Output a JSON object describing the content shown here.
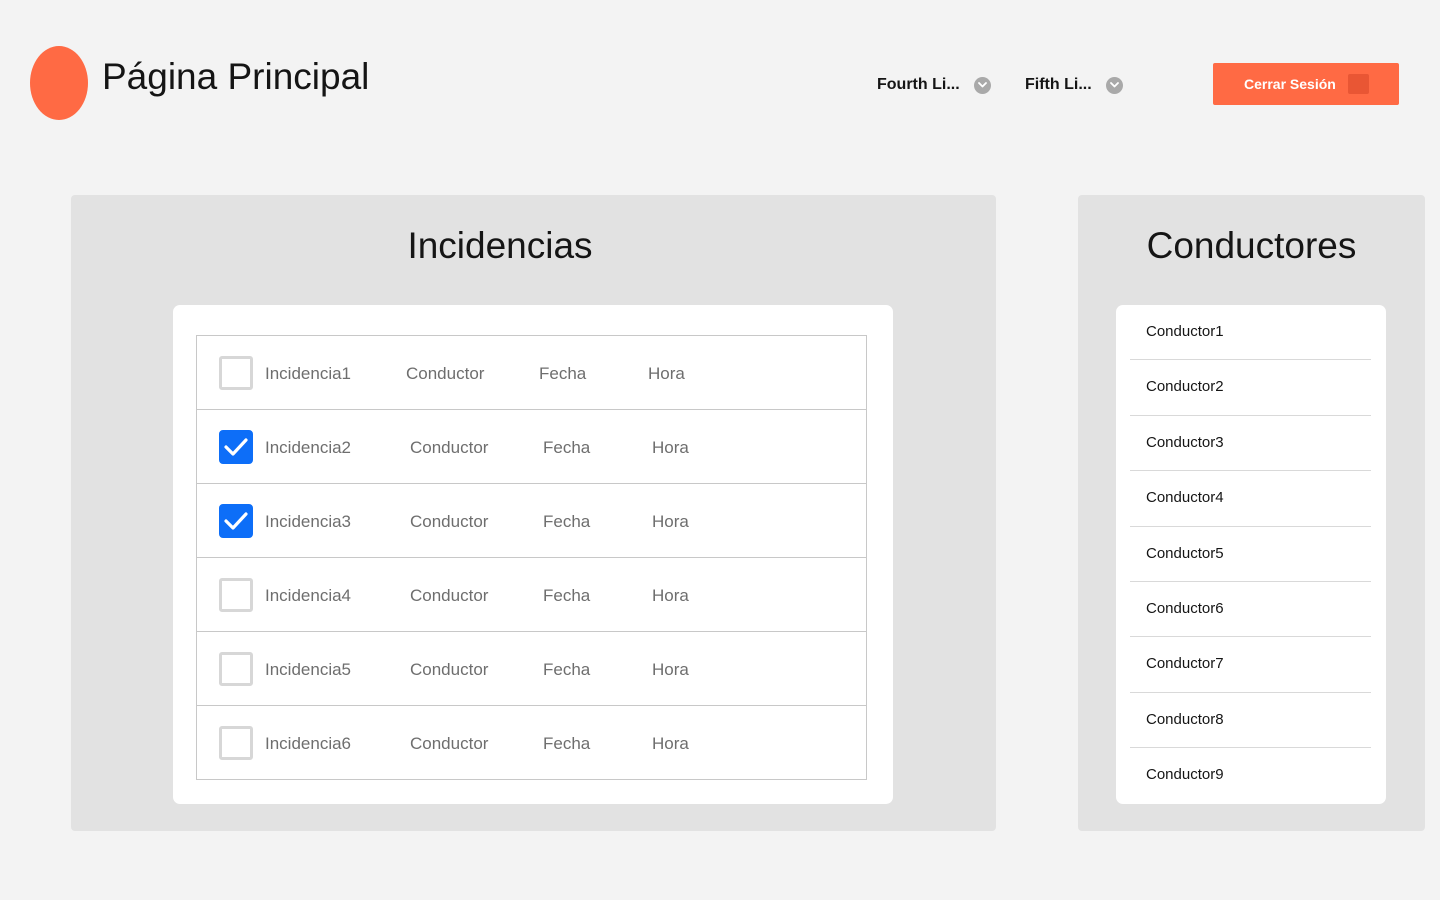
{
  "header": {
    "title": "Página Principal",
    "nav": [
      {
        "label": "Fourth Li...",
        "icon": "chevron-down-icon"
      },
      {
        "label": "Fifth Li...",
        "icon": "chevron-down-icon"
      }
    ],
    "logout_label": "Cerrar Sesión",
    "logout_icon": "logout-icon"
  },
  "colors": {
    "accent": "#ff6a44",
    "checked": "#0d6ef8",
    "panel": "#e2e2e2",
    "background": "#f3f3f3"
  },
  "incidencias": {
    "title": "Incidencias",
    "rows": [
      {
        "name": "Incidencia1",
        "conductor": "Conductor",
        "fecha": "Fecha",
        "hora": "Hora",
        "checked": false
      },
      {
        "name": "Incidencia2",
        "conductor": "Conductor",
        "fecha": "Fecha",
        "hora": "Hora",
        "checked": true
      },
      {
        "name": "Incidencia3",
        "conductor": "Conductor",
        "fecha": "Fecha",
        "hora": "Hora",
        "checked": true
      },
      {
        "name": "Incidencia4",
        "conductor": "Conductor",
        "fecha": "Fecha",
        "hora": "Hora",
        "checked": false
      },
      {
        "name": "Incidencia5",
        "conductor": "Conductor",
        "fecha": "Fecha",
        "hora": "Hora",
        "checked": false
      },
      {
        "name": "Incidencia6",
        "conductor": "Conductor",
        "fecha": "Fecha",
        "hora": "Hora",
        "checked": false
      }
    ]
  },
  "conductores": {
    "title": "Conductores",
    "items": [
      "Conductor1",
      "Conductor2",
      "Conductor3",
      "Conductor4",
      "Conductor5",
      "Conductor6",
      "Conductor7",
      "Conductor8",
      "Conductor9"
    ]
  }
}
